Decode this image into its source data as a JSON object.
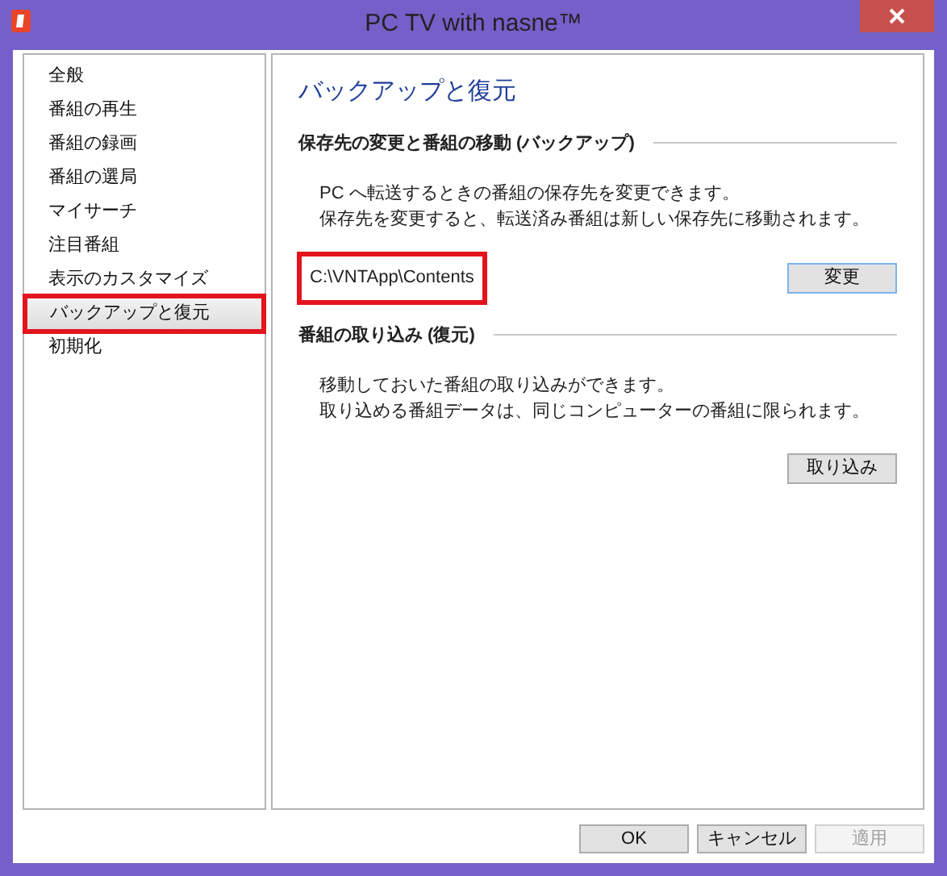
{
  "window": {
    "title": "PC TV with nasne™"
  },
  "sidebar": {
    "items": [
      {
        "label": "全般",
        "selected": false,
        "highlighted": false
      },
      {
        "label": "番組の再生",
        "selected": false,
        "highlighted": false
      },
      {
        "label": "番組の録画",
        "selected": false,
        "highlighted": false
      },
      {
        "label": "番組の選局",
        "selected": false,
        "highlighted": false
      },
      {
        "label": "マイサーチ",
        "selected": false,
        "highlighted": false
      },
      {
        "label": "注目番組",
        "selected": false,
        "highlighted": false
      },
      {
        "label": "表示のカスタマイズ",
        "selected": false,
        "highlighted": false
      },
      {
        "label": "バックアップと復元",
        "selected": true,
        "highlighted": true
      },
      {
        "label": "初期化",
        "selected": false,
        "highlighted": false
      }
    ]
  },
  "content": {
    "title": "バックアップと復元",
    "sections": [
      {
        "heading": "保存先の変更と番組の移動 (バックアップ)",
        "lines": [
          "PC へ転送するときの番組の保存先を変更できます。",
          "保存先を変更すると、転送済み番組は新しい保存先に移動されます。"
        ],
        "path": {
          "value": "C:\\VNTApp\\Contents",
          "highlighted": true
        },
        "button": "変更",
        "button_focused": true
      },
      {
        "heading": "番組の取り込み (復元)",
        "lines": [
          "移動しておいた番組の取り込みができます。",
          "取り込める番組データは、同じコンピューターの番組に限られます。"
        ],
        "button": "取り込み",
        "button_focused": false
      }
    ]
  },
  "buttons": [
    {
      "label": "OK",
      "disabled": false
    },
    {
      "label": "キャンセル",
      "disabled": false
    },
    {
      "label": "適用",
      "disabled": true
    }
  ]
}
